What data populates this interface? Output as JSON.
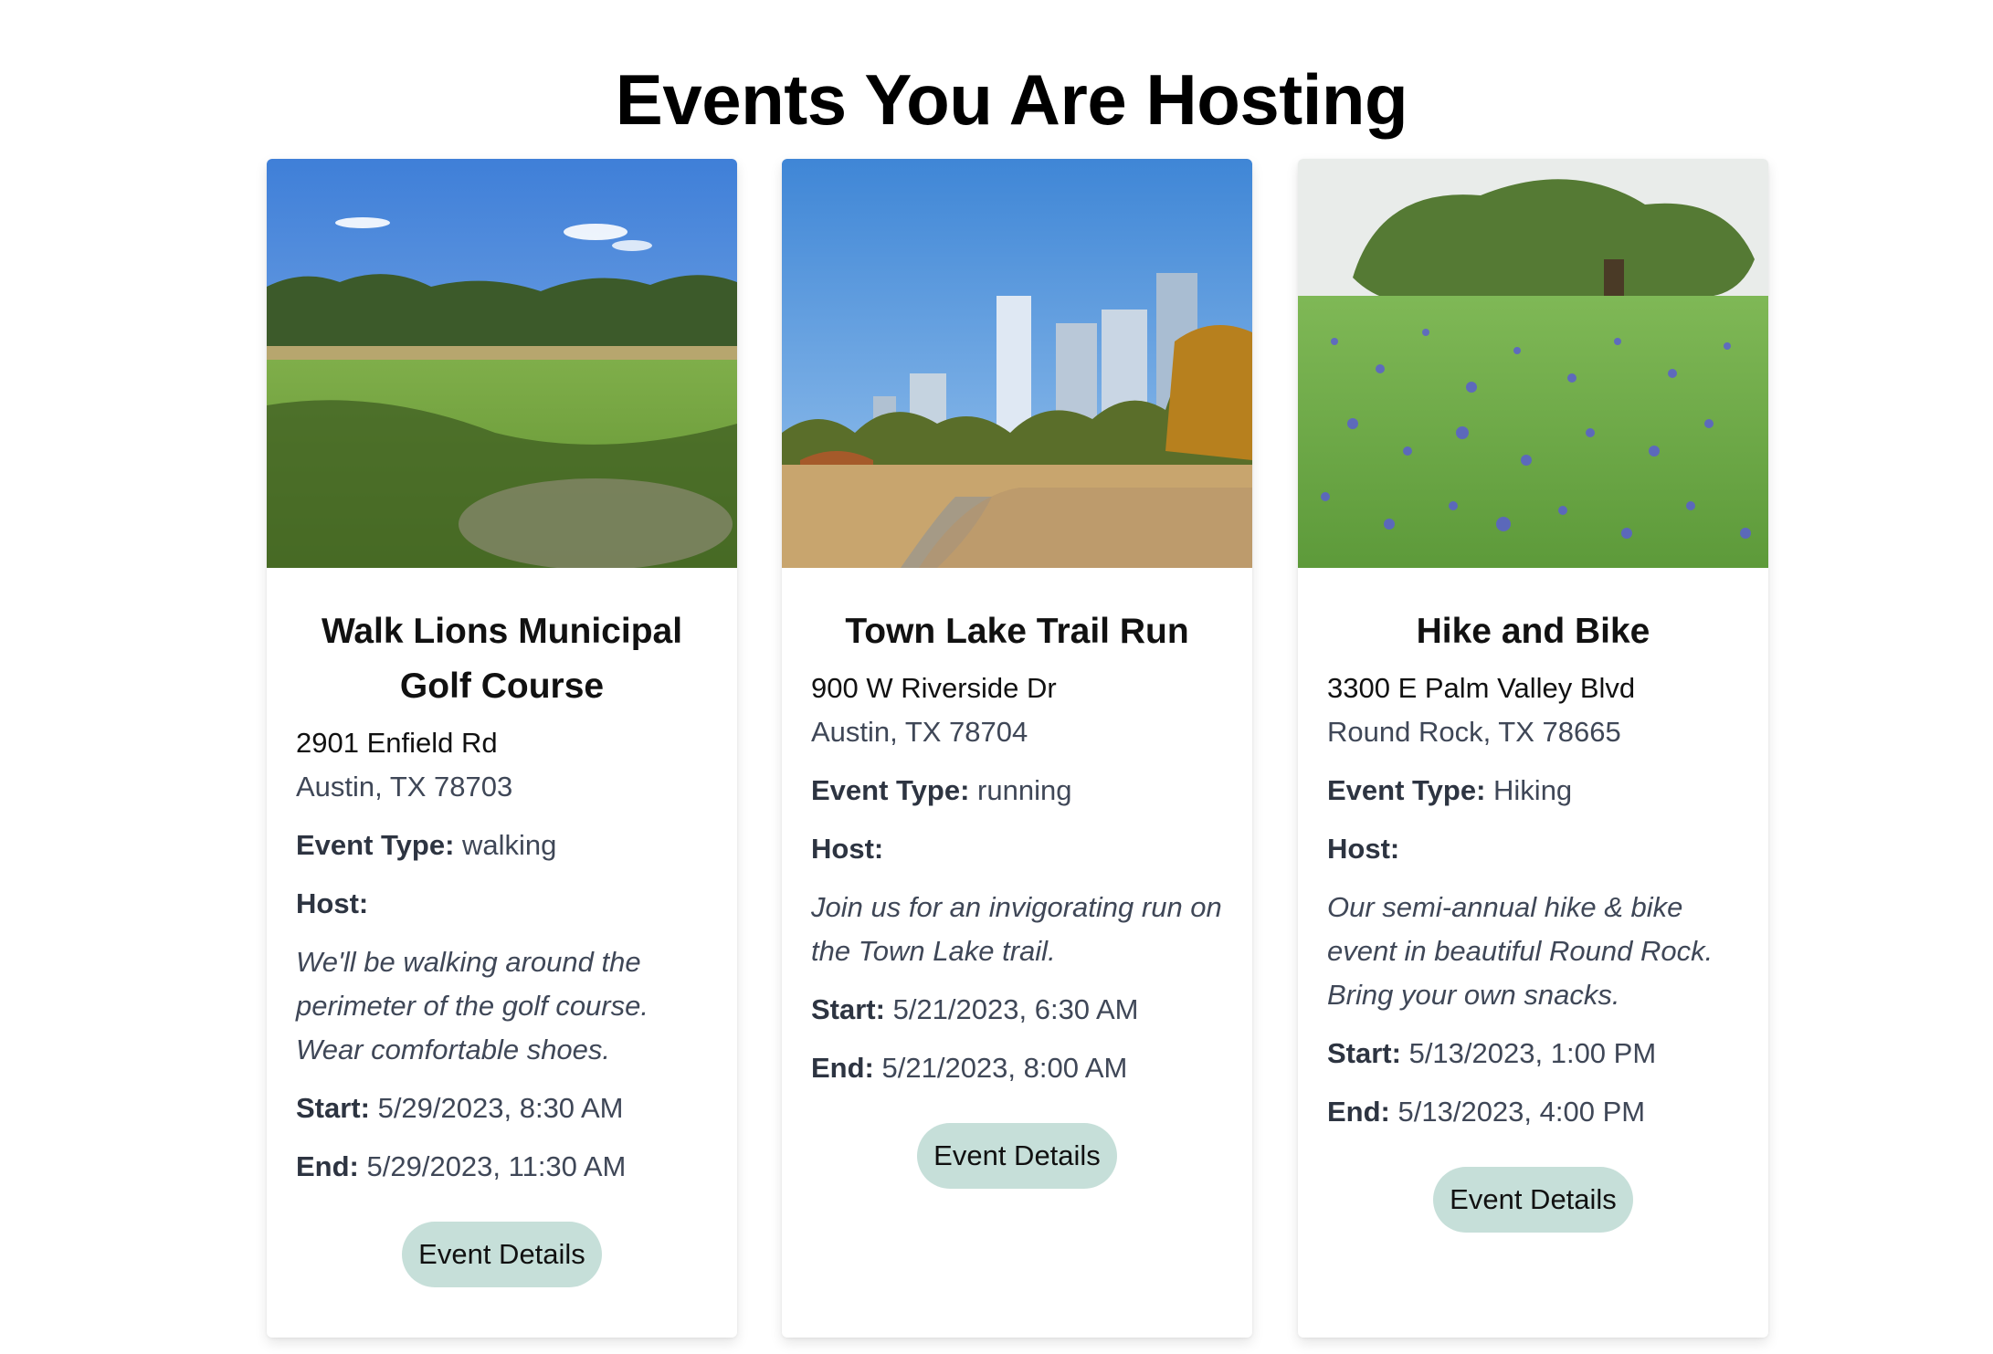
{
  "header": {
    "title": "Events You Are Hosting"
  },
  "events": [
    {
      "title": "Walk Lions Municipal Golf Course",
      "address_line1": "2901 Enfield Rd",
      "address_line2": "Austin, TX 78703",
      "event_type_label": "Event Type:",
      "event_type": "walking",
      "host_label": "Host:",
      "description": "We'll be walking around the perimeter of the golf course. Wear comfortable shoes.",
      "start_label": "Start:",
      "start": "5/29/2023, 8:30 AM",
      "end_label": "End:",
      "end": "5/29/2023, 11:30 AM",
      "button_label": "Event Details"
    },
    {
      "title": "Town Lake Trail Run",
      "address_line1": "900 W Riverside Dr",
      "address_line2": "Austin, TX 78704",
      "event_type_label": "Event Type:",
      "event_type": "running",
      "host_label": "Host:",
      "description": "Join us for an invigorating run on the Town Lake trail.",
      "start_label": "Start:",
      "start": "5/21/2023, 6:30 AM",
      "end_label": "End:",
      "end": "5/21/2023, 8:00 AM",
      "button_label": "Event Details"
    },
    {
      "title": "Hike and Bike",
      "address_line1": "3300 E Palm Valley Blvd",
      "address_line2": "Round Rock, TX 78665",
      "event_type_label": "Event Type:",
      "event_type": "Hiking",
      "host_label": "Host:",
      "description": "Our semi-annual hike & bike event in beautiful Round Rock. Bring your own snacks.",
      "start_label": "Start:",
      "start": "5/13/2023, 1:00 PM",
      "end_label": "End:",
      "end": "5/13/2023, 4:00 PM",
      "button_label": "Event Details"
    }
  ]
}
